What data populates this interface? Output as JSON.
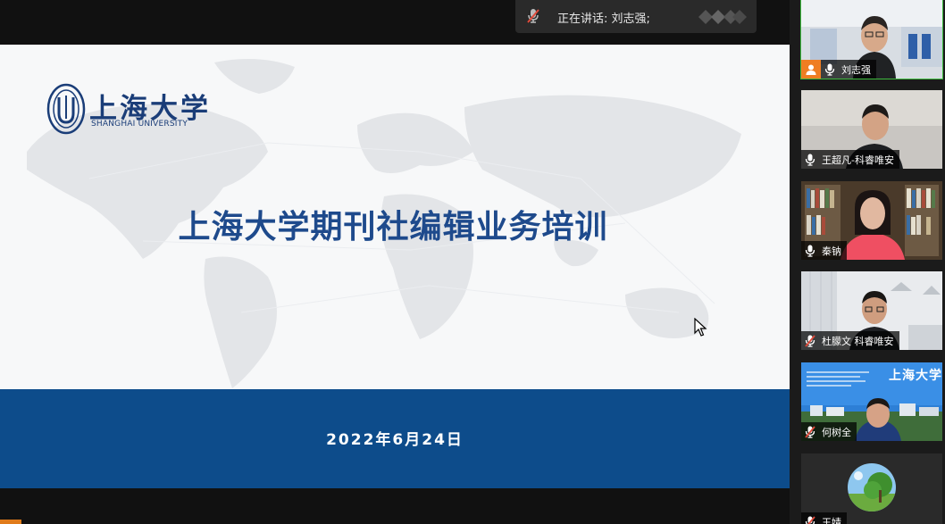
{
  "slide": {
    "logo_cn": "上海大学",
    "logo_en": "SHANGHAI UNIVERSITY",
    "title": "上海大学期刊社编辑业务培训",
    "date": "2022年6月24日"
  },
  "speaking": {
    "label": "正在讲话: 刘志强;"
  },
  "participants": [
    {
      "name": "刘志强",
      "muted": false,
      "host": true,
      "active": true
    },
    {
      "name": "王超凡-科睿唯安",
      "muted": false,
      "host": false
    },
    {
      "name": "秦钠",
      "muted": false,
      "host": false
    },
    {
      "name": "杜朦文 科睿唯安",
      "muted": true,
      "host": false
    },
    {
      "name": "何树全",
      "muted": true,
      "host": false
    },
    {
      "name": "王婧",
      "muted": true,
      "host": false
    }
  ],
  "tile5_slide_logo": "上海大学",
  "colors": {
    "title": "#1e4a8c",
    "band": "#0d4c8b",
    "active_border": "#3dbb3d",
    "host_badge": "#ef7d22",
    "muted_icon": "#e04a3a"
  },
  "icons": {
    "mic": "microphone-icon",
    "mic_off": "microphone-off-icon",
    "host": "person-icon",
    "cursor": "mouse-pointer-icon"
  }
}
